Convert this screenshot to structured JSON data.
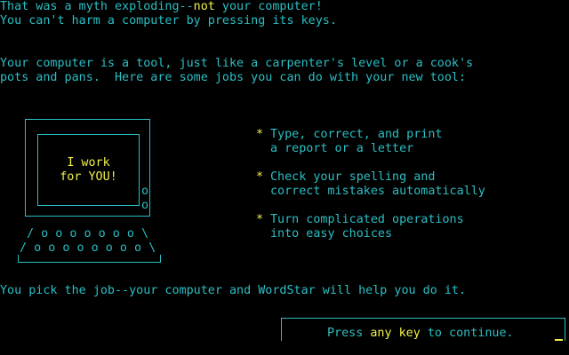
{
  "intro": {
    "line1_a": "That was a myth exploding--",
    "line1_b": "not",
    "line1_c": " your computer!",
    "line2": "You can't harm a computer by pressing its keys."
  },
  "tool": {
    "line1": "Your computer is a tool, just like a carpenter's level or a cook's",
    "line2": "pots and pans.  Here are some jobs you can do with your new tool:"
  },
  "monitor": {
    "screen_line1": "I work",
    "screen_line2": "for YOU!",
    "knob": "o",
    "keys_row1": "/ o o o o o o o \\",
    "keys_row2": "/ o o o o o o o o \\"
  },
  "jobs": [
    {
      "bullet": "*",
      "line1": "Type, correct, and print",
      "line2": "a report or a letter"
    },
    {
      "bullet": "*",
      "line1": "Check your spelling and",
      "line2": "correct mistakes automatically"
    },
    {
      "bullet": "*",
      "line1": "Turn complicated operations",
      "line2": "into easy choices"
    }
  ],
  "footer": "You pick the job--your computer and WordStar will help you do it.",
  "prompt": {
    "a": "Press ",
    "b": "any key",
    "c": " to continue."
  }
}
